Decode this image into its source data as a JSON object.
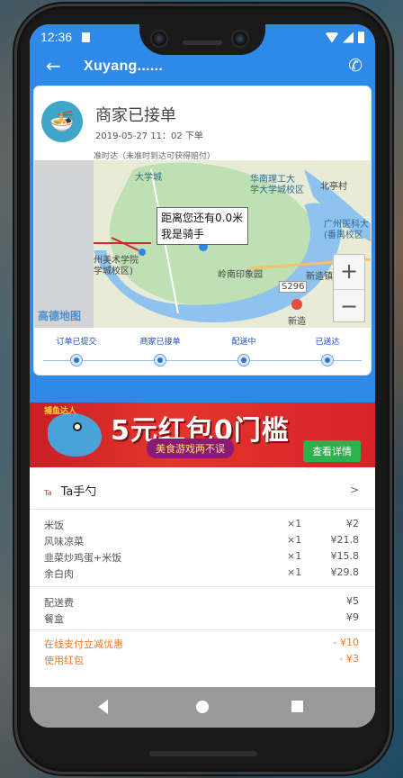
{
  "status_bar": {
    "time": "12:36"
  },
  "app_bar": {
    "back_icon": "←",
    "title": "Xuyang......",
    "phone_icon": "✆"
  },
  "order_status": {
    "title": "商家已接单",
    "time": "2019-05-27 11：02 下单",
    "note": "准时达（未准时到达可获得赔付）",
    "avatar_icon": "bowl-icon"
  },
  "map": {
    "bubble_line1": "距离您还有0.0米",
    "bubble_line2": "我是骑手",
    "labels": [
      {
        "text": "大学城",
        "cls": ""
      },
      {
        "text": "华南理工大",
        "cls": ""
      },
      {
        "text": "学大学城校区",
        "cls": ""
      },
      {
        "text": "北亭村",
        "cls": "dark"
      },
      {
        "text": "广州医科大",
        "cls": ""
      },
      {
        "text": "(番禺校区",
        "cls": ""
      },
      {
        "text": "州美术学院",
        "cls": ""
      },
      {
        "text": "学城校区)",
        "cls": ""
      },
      {
        "text": "岭南印象园",
        "cls": "dark"
      },
      {
        "text": "新造镇",
        "cls": "dark"
      },
      {
        "text": "新造",
        "cls": "dark"
      },
      {
        "text": "S296",
        "cls": "dark"
      }
    ],
    "zoom_in": "+",
    "zoom_out": "−",
    "logo": "高德地图"
  },
  "steps": [
    "订单已提交",
    "商家已接单",
    "配送中",
    "已送达"
  ],
  "banner": {
    "logo": "捕鱼达人",
    "headline": "5元红包0门槛",
    "sub": "美食游戏两不误",
    "button": "查看详情"
  },
  "order": {
    "shop_mark": "Ta",
    "shop_name": "Ta手勺",
    "chevron": ">",
    "items": [
      {
        "name": "米饭",
        "qty": "×1",
        "price": "¥2"
      },
      {
        "name": "风味凉菜",
        "qty": "×1",
        "price": "¥21.8"
      },
      {
        "name": "韭菜炒鸡蛋+米饭",
        "qty": "×1",
        "price": "¥15.8"
      },
      {
        "name": "余白肉",
        "qty": "×1",
        "price": "¥29.8"
      }
    ],
    "fees": [
      {
        "name": "配送费",
        "price": "¥5"
      },
      {
        "name": "餐盒",
        "price": "¥9"
      }
    ],
    "promos": [
      {
        "name": "在线支付立减优惠",
        "price": "- ¥10"
      },
      {
        "name": "使用红包",
        "price": "- ¥3"
      }
    ]
  },
  "colors": {
    "primary": "#2e89e8",
    "promo": "#f07a2a",
    "step": "#1f4ec9"
  }
}
